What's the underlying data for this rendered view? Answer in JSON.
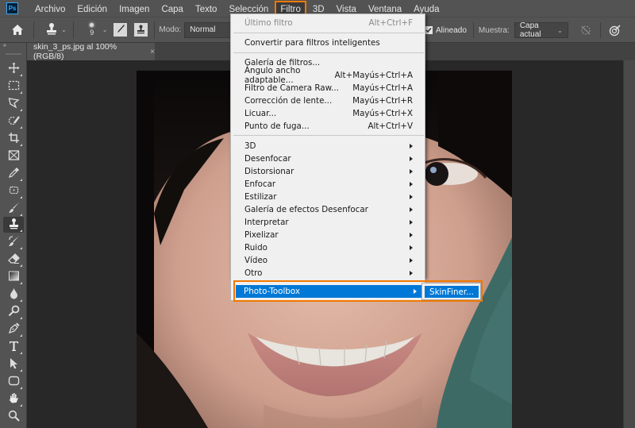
{
  "app": {
    "logo": "Ps"
  },
  "menubar": {
    "items": [
      {
        "label": "Archivo"
      },
      {
        "label": "Edición"
      },
      {
        "label": "Imagen"
      },
      {
        "label": "Capa"
      },
      {
        "label": "Texto"
      },
      {
        "label": "Selección"
      },
      {
        "label": "Filtro",
        "active": true
      },
      {
        "label": "3D"
      },
      {
        "label": "Vista"
      },
      {
        "label": "Ventana"
      },
      {
        "label": "Ayuda"
      }
    ]
  },
  "options_bar": {
    "home_icon": "home-icon",
    "tool_icon": "clone-stamp-icon",
    "brush_size": "9",
    "mode_label": "Modo:",
    "mode_value": "Normal",
    "aligned_label": "Alineado",
    "aligned_checked": true,
    "sample_label": "Muestra:",
    "sample_value": "Capa actual"
  },
  "document": {
    "tab_title": "skin_3_ps.jpg al 100% (RGB/8)",
    "close_glyph": "×"
  },
  "toolbar": {
    "collapse_glyph": "»",
    "tools": [
      "move",
      "marquee",
      "lasso",
      "quick-selection",
      "crop",
      "frame",
      "eyedropper",
      "healing-brush",
      "brush",
      "clone-stamp",
      "history-brush",
      "eraser",
      "gradient",
      "blur",
      "dodge",
      "pen",
      "type",
      "path-selection",
      "rectangle",
      "hand",
      "zoom"
    ],
    "selected_tool": "clone-stamp"
  },
  "filter_menu": {
    "items": [
      {
        "label": "Último filtro",
        "shortcut": "Alt+Ctrl+F",
        "disabled": true
      },
      {
        "separator": true
      },
      {
        "label": "Convertir para filtros inteligentes"
      },
      {
        "separator": true
      },
      {
        "label": "Galería de filtros..."
      },
      {
        "label": "Ángulo ancho adaptable...",
        "shortcut": "Alt+Mayús+Ctrl+A"
      },
      {
        "label": "Filtro de Camera Raw...",
        "shortcut": "Mayús+Ctrl+A"
      },
      {
        "label": "Corrección de lente...",
        "shortcut": "Mayús+Ctrl+R"
      },
      {
        "label": "Licuar...",
        "shortcut": "Mayús+Ctrl+X"
      },
      {
        "label": "Punto de fuga...",
        "shortcut": "Alt+Ctrl+V"
      },
      {
        "separator": true
      },
      {
        "label": "3D",
        "submenu": true
      },
      {
        "label": "Desenfocar",
        "submenu": true
      },
      {
        "label": "Distorsionar",
        "submenu": true
      },
      {
        "label": "Enfocar",
        "submenu": true
      },
      {
        "label": "Estilizar",
        "submenu": true
      },
      {
        "label": "Galería de efectos Desenfocar",
        "submenu": true
      },
      {
        "label": "Interpretar",
        "submenu": true
      },
      {
        "label": "Pixelizar",
        "submenu": true
      },
      {
        "label": "Ruido",
        "submenu": true
      },
      {
        "label": "Vídeo",
        "submenu": true
      },
      {
        "label": "Otro",
        "submenu": true
      }
    ],
    "highlighted": {
      "label": "Photo-Toolbox",
      "submenu": true
    },
    "submenu_items": [
      {
        "label": "SkinFiner..."
      }
    ]
  },
  "colors": {
    "highlight": "#0078d7",
    "annotation": "#f07800",
    "panel": "#535353",
    "canvas_bg": "#282828"
  }
}
